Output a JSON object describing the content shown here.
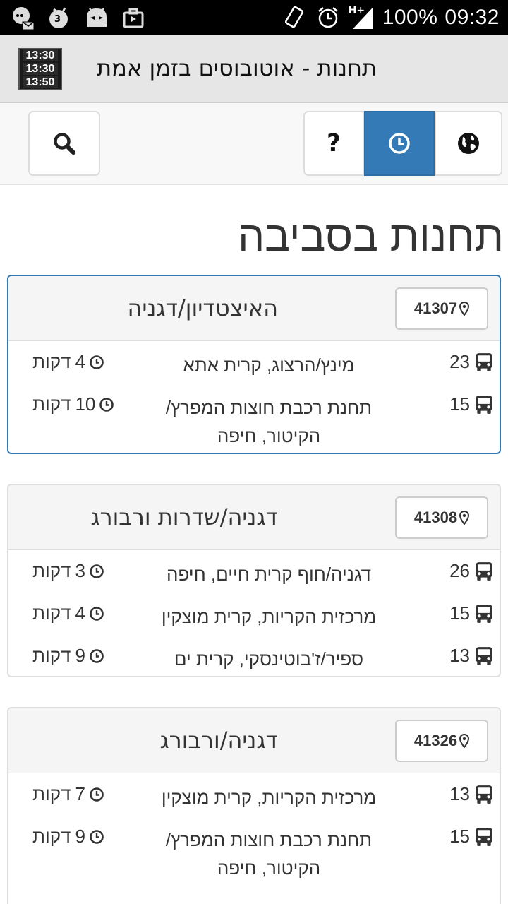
{
  "status_bar": {
    "battery": "100%",
    "time": "09:32",
    "network": "H+",
    "notification_count": "3"
  },
  "app": {
    "title": "תחנות - אוטובוסים בזמן אמת",
    "icon_rows": [
      "13:30",
      "13:30",
      "13:50"
    ]
  },
  "toolbar": {
    "help_label": "?"
  },
  "page": {
    "title": "תחנות בסביבה"
  },
  "colors": {
    "accent": "#337ab7"
  },
  "stations": [
    {
      "name": "האיצטדיון/דגניה",
      "code": "41307",
      "arrivals": [
        {
          "route": "23",
          "destination": "מינץ/הרצוג, קרית אתא",
          "minutes": "4",
          "unit": "דקות"
        },
        {
          "route": "15",
          "destination": "תחנת רכבת חוצות המפרץ/ הקיטור, חיפה",
          "minutes": "10",
          "unit": "דקות"
        }
      ]
    },
    {
      "name": "דגניה/שדרות ורבורג",
      "code": "41308",
      "arrivals": [
        {
          "route": "26",
          "destination": "דגניה/חוף קרית חיים, חיפה",
          "minutes": "3",
          "unit": "דקות"
        },
        {
          "route": "15",
          "destination": "מרכזית הקריות, קרית מוצקין",
          "minutes": "4",
          "unit": "דקות"
        },
        {
          "route": "13",
          "destination": "ספיר/ז'בוטינסקי, קרית ים",
          "minutes": "9",
          "unit": "דקות"
        }
      ]
    },
    {
      "name": "דגניה/ורבורג",
      "code": "41326",
      "arrivals": [
        {
          "route": "13",
          "destination": "מרכזית הקריות, קרית מוצקין",
          "minutes": "7",
          "unit": "דקות"
        },
        {
          "route": "15",
          "destination": "תחנת רכבת חוצות המפרץ/ הקיטור, חיפה",
          "minutes": "9",
          "unit": "דקות"
        }
      ]
    }
  ]
}
